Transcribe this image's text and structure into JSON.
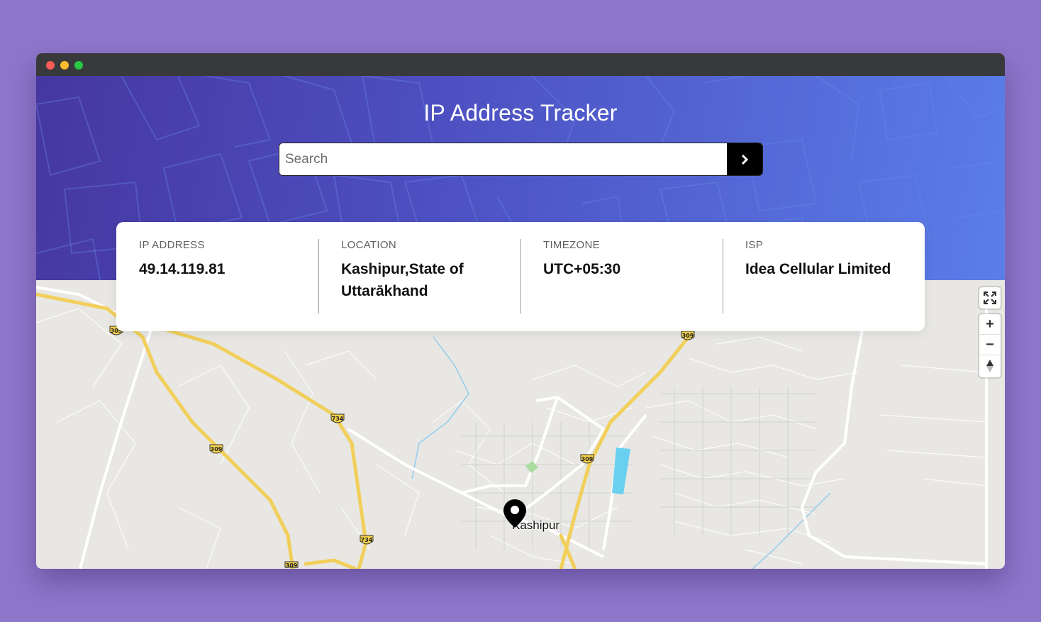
{
  "header": {
    "title": "IP Address Tracker"
  },
  "search": {
    "placeholder": "Search",
    "value": "",
    "submit_icon": "chevron-right-icon"
  },
  "info": {
    "ip": {
      "label": "IP ADDRESS",
      "value": "49.14.119.81"
    },
    "location": {
      "label": "LOCATION",
      "value": "Kashipur,State of Uttarākhand"
    },
    "timezone": {
      "label": "TIMEZONE",
      "value": "UTC+05:30"
    },
    "isp": {
      "label": "ISP",
      "value": "Idea Cellular Limited"
    }
  },
  "map": {
    "place_label": "Kashipur",
    "controls": {
      "fullscreen": "fullscreen-icon",
      "zoom_in": "+",
      "zoom_out": "−",
      "compass": "compass-icon"
    },
    "road_shields": [
      "309",
      "309",
      "734",
      "309",
      "734",
      "309",
      "309"
    ]
  },
  "colors": {
    "page_bg": "#8e76cb",
    "header_gradient_start": "#4637a0",
    "header_gradient_end": "#5a7ee9",
    "highway": "#f2cf5b",
    "water": "#6ad0f0"
  }
}
